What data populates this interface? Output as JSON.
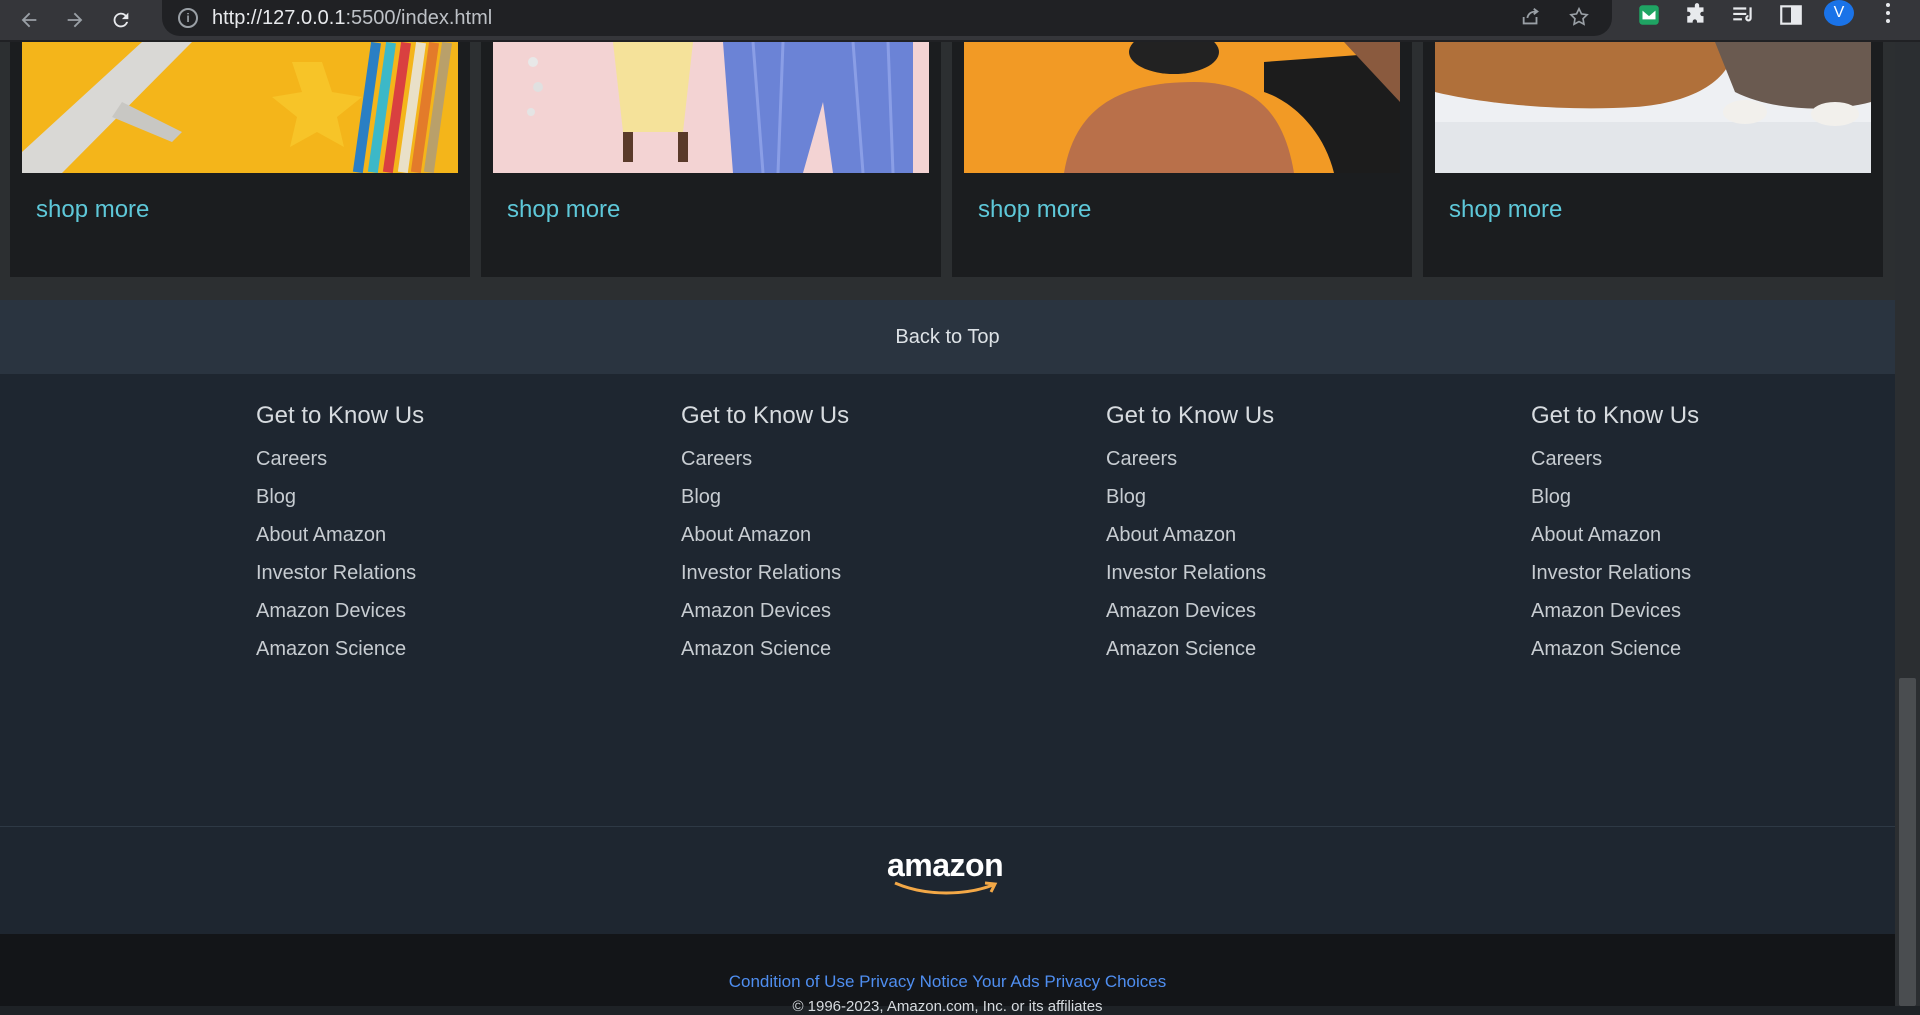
{
  "browser": {
    "url_host": "http://127.0.0.1",
    "url_rest": ":5500/index.html",
    "avatar_letter": "V"
  },
  "cards": [
    {
      "link": "shop more"
    },
    {
      "link": "shop more"
    },
    {
      "link": "shop more"
    },
    {
      "link": "shop more"
    }
  ],
  "back_to_top": "Back to Top",
  "footer_columns": [
    {
      "heading": "Get to Know Us",
      "items": [
        "Careers",
        "Blog",
        "About Amazon",
        "Investor Relations",
        "Amazon Devices",
        "Amazon Science"
      ]
    },
    {
      "heading": "Get to Know Us",
      "items": [
        "Careers",
        "Blog",
        "About Amazon",
        "Investor Relations",
        "Amazon Devices",
        "Amazon Science"
      ]
    },
    {
      "heading": "Get to Know Us",
      "items": [
        "Careers",
        "Blog",
        "About Amazon",
        "Investor Relations",
        "Amazon Devices",
        "Amazon Science"
      ]
    },
    {
      "heading": "Get to Know Us",
      "items": [
        "Careers",
        "Blog",
        "About Amazon",
        "Investor Relations",
        "Amazon Devices",
        "Amazon Science"
      ]
    }
  ],
  "logo_text": "amazon",
  "bottom_links": [
    "Condition of Use",
    "Privacy Notice",
    "Your Ads Privacy Choices"
  ],
  "copyright": "© 1996-2023, Amazon.com, Inc. or its affiliates",
  "colors": {
    "link_teal": "#5ec8d9",
    "link_blue": "#4f8ef0",
    "logo_smile": "#f3a847"
  }
}
